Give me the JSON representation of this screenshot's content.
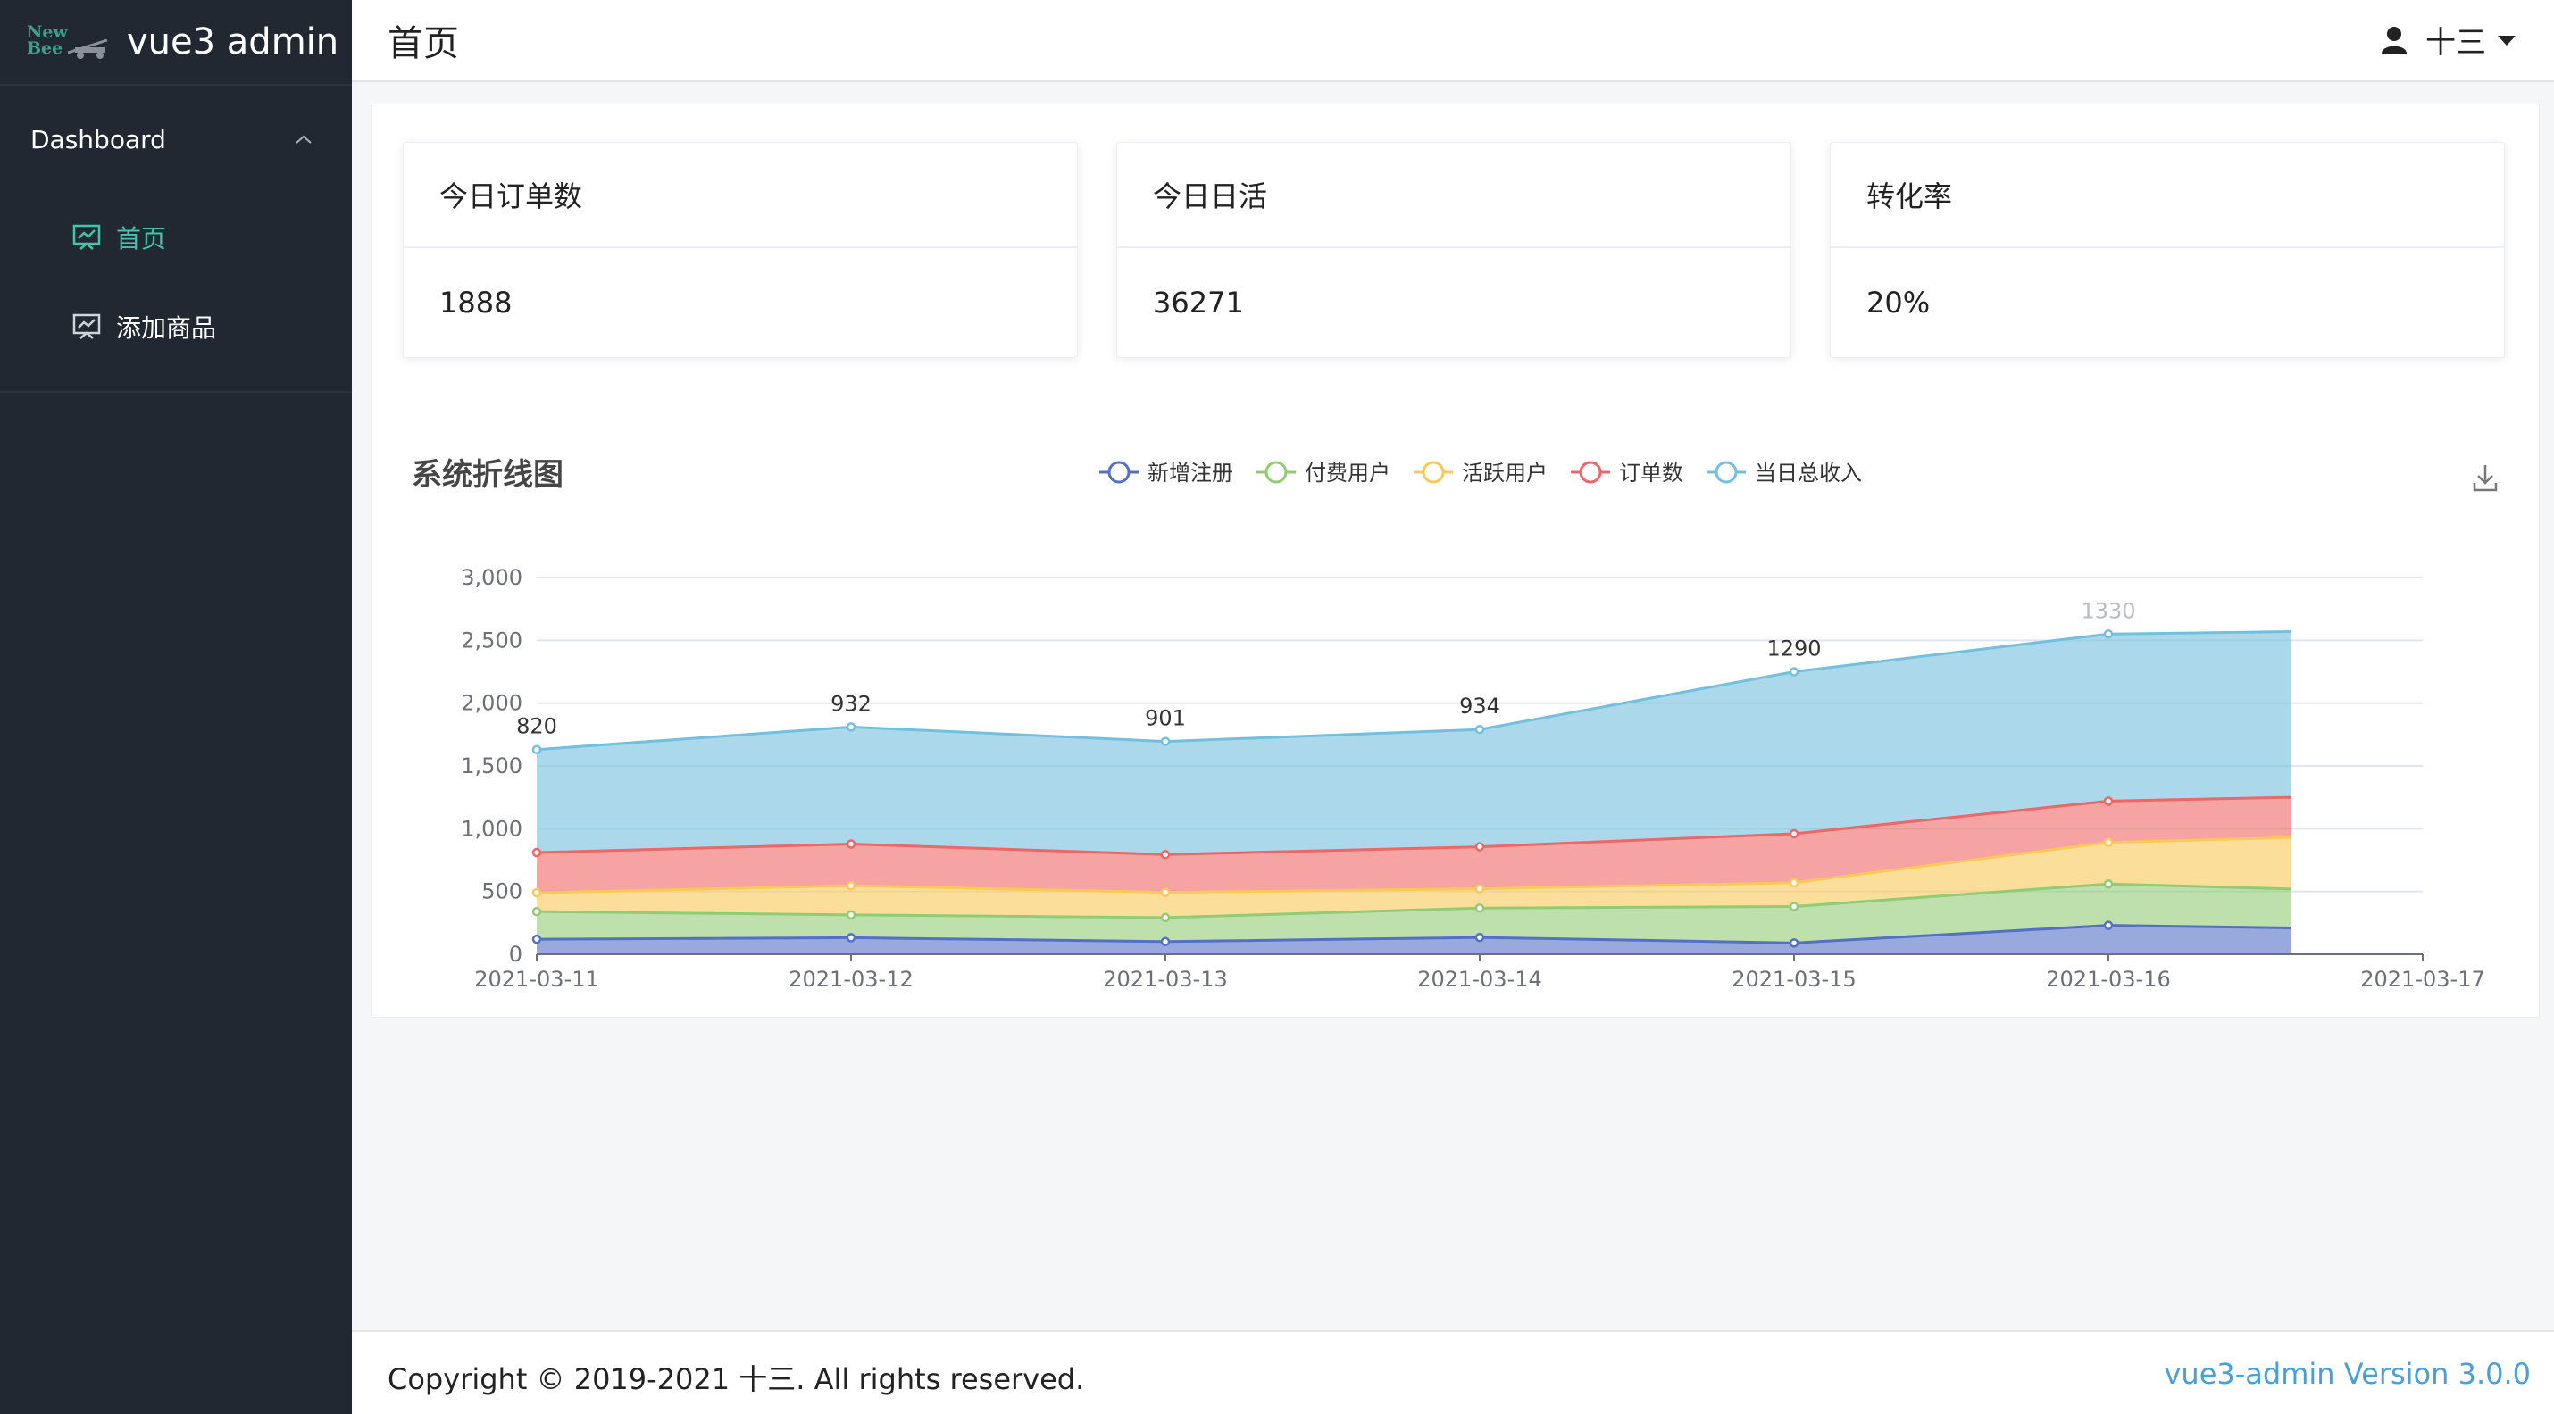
{
  "app": {
    "logo_line1": "New",
    "logo_line2": "Bee",
    "title": "vue3 admin"
  },
  "sidebar": {
    "group_label": "Dashboard",
    "items": [
      {
        "label": "首页",
        "active": true
      },
      {
        "label": "添加商品",
        "active": false
      }
    ]
  },
  "header": {
    "page_title": "首页",
    "user_name": "十三"
  },
  "cards": [
    {
      "title": "今日订单数",
      "value": "1888"
    },
    {
      "title": "今日日活",
      "value": "36271"
    },
    {
      "title": "转化率",
      "value": "20%"
    }
  ],
  "colors": {
    "accent": "#3ec7ae",
    "sidebar_bg": "#222831",
    "link": "#4a9fd8"
  },
  "chart_data": {
    "type": "area",
    "title": "系统折线图",
    "x": [
      "2021-03-11",
      "2021-03-12",
      "2021-03-13",
      "2021-03-14",
      "2021-03-15",
      "2021-03-16",
      "2021-03-17"
    ],
    "stacked": true,
    "ylim": [
      0,
      3000
    ],
    "yticks": [
      "0",
      "500",
      "1,000",
      "1,500",
      "2,000",
      "2,500",
      "3,000"
    ],
    "grid": true,
    "legend_position": "top-center",
    "series": [
      {
        "name": "新增注册",
        "color": "#5470c6",
        "values": [
          120,
          132,
          101,
          134,
          90,
          230,
          210
        ]
      },
      {
        "name": "付费用户",
        "color": "#91cc75",
        "values": [
          220,
          182,
          191,
          234,
          290,
          330,
          310
        ]
      },
      {
        "name": "活跃用户",
        "color": "#fac858",
        "values": [
          150,
          232,
          201,
          154,
          190,
          330,
          410
        ]
      },
      {
        "name": "订单数",
        "color": "#ee6666",
        "values": [
          320,
          332,
          301,
          334,
          390,
          330,
          320
        ]
      },
      {
        "name": "当日总收入",
        "color": "#73c0de",
        "values": [
          820,
          932,
          901,
          934,
          1290,
          1330,
          1320
        ]
      }
    ],
    "data_labels": [
      "820",
      "932",
      "901",
      "934",
      "1290",
      "1330"
    ]
  },
  "footer": {
    "copyright": "Copyright © 2019-2021 十三. All rights reserved.",
    "version": "vue3-admin Version 3.0.0"
  }
}
